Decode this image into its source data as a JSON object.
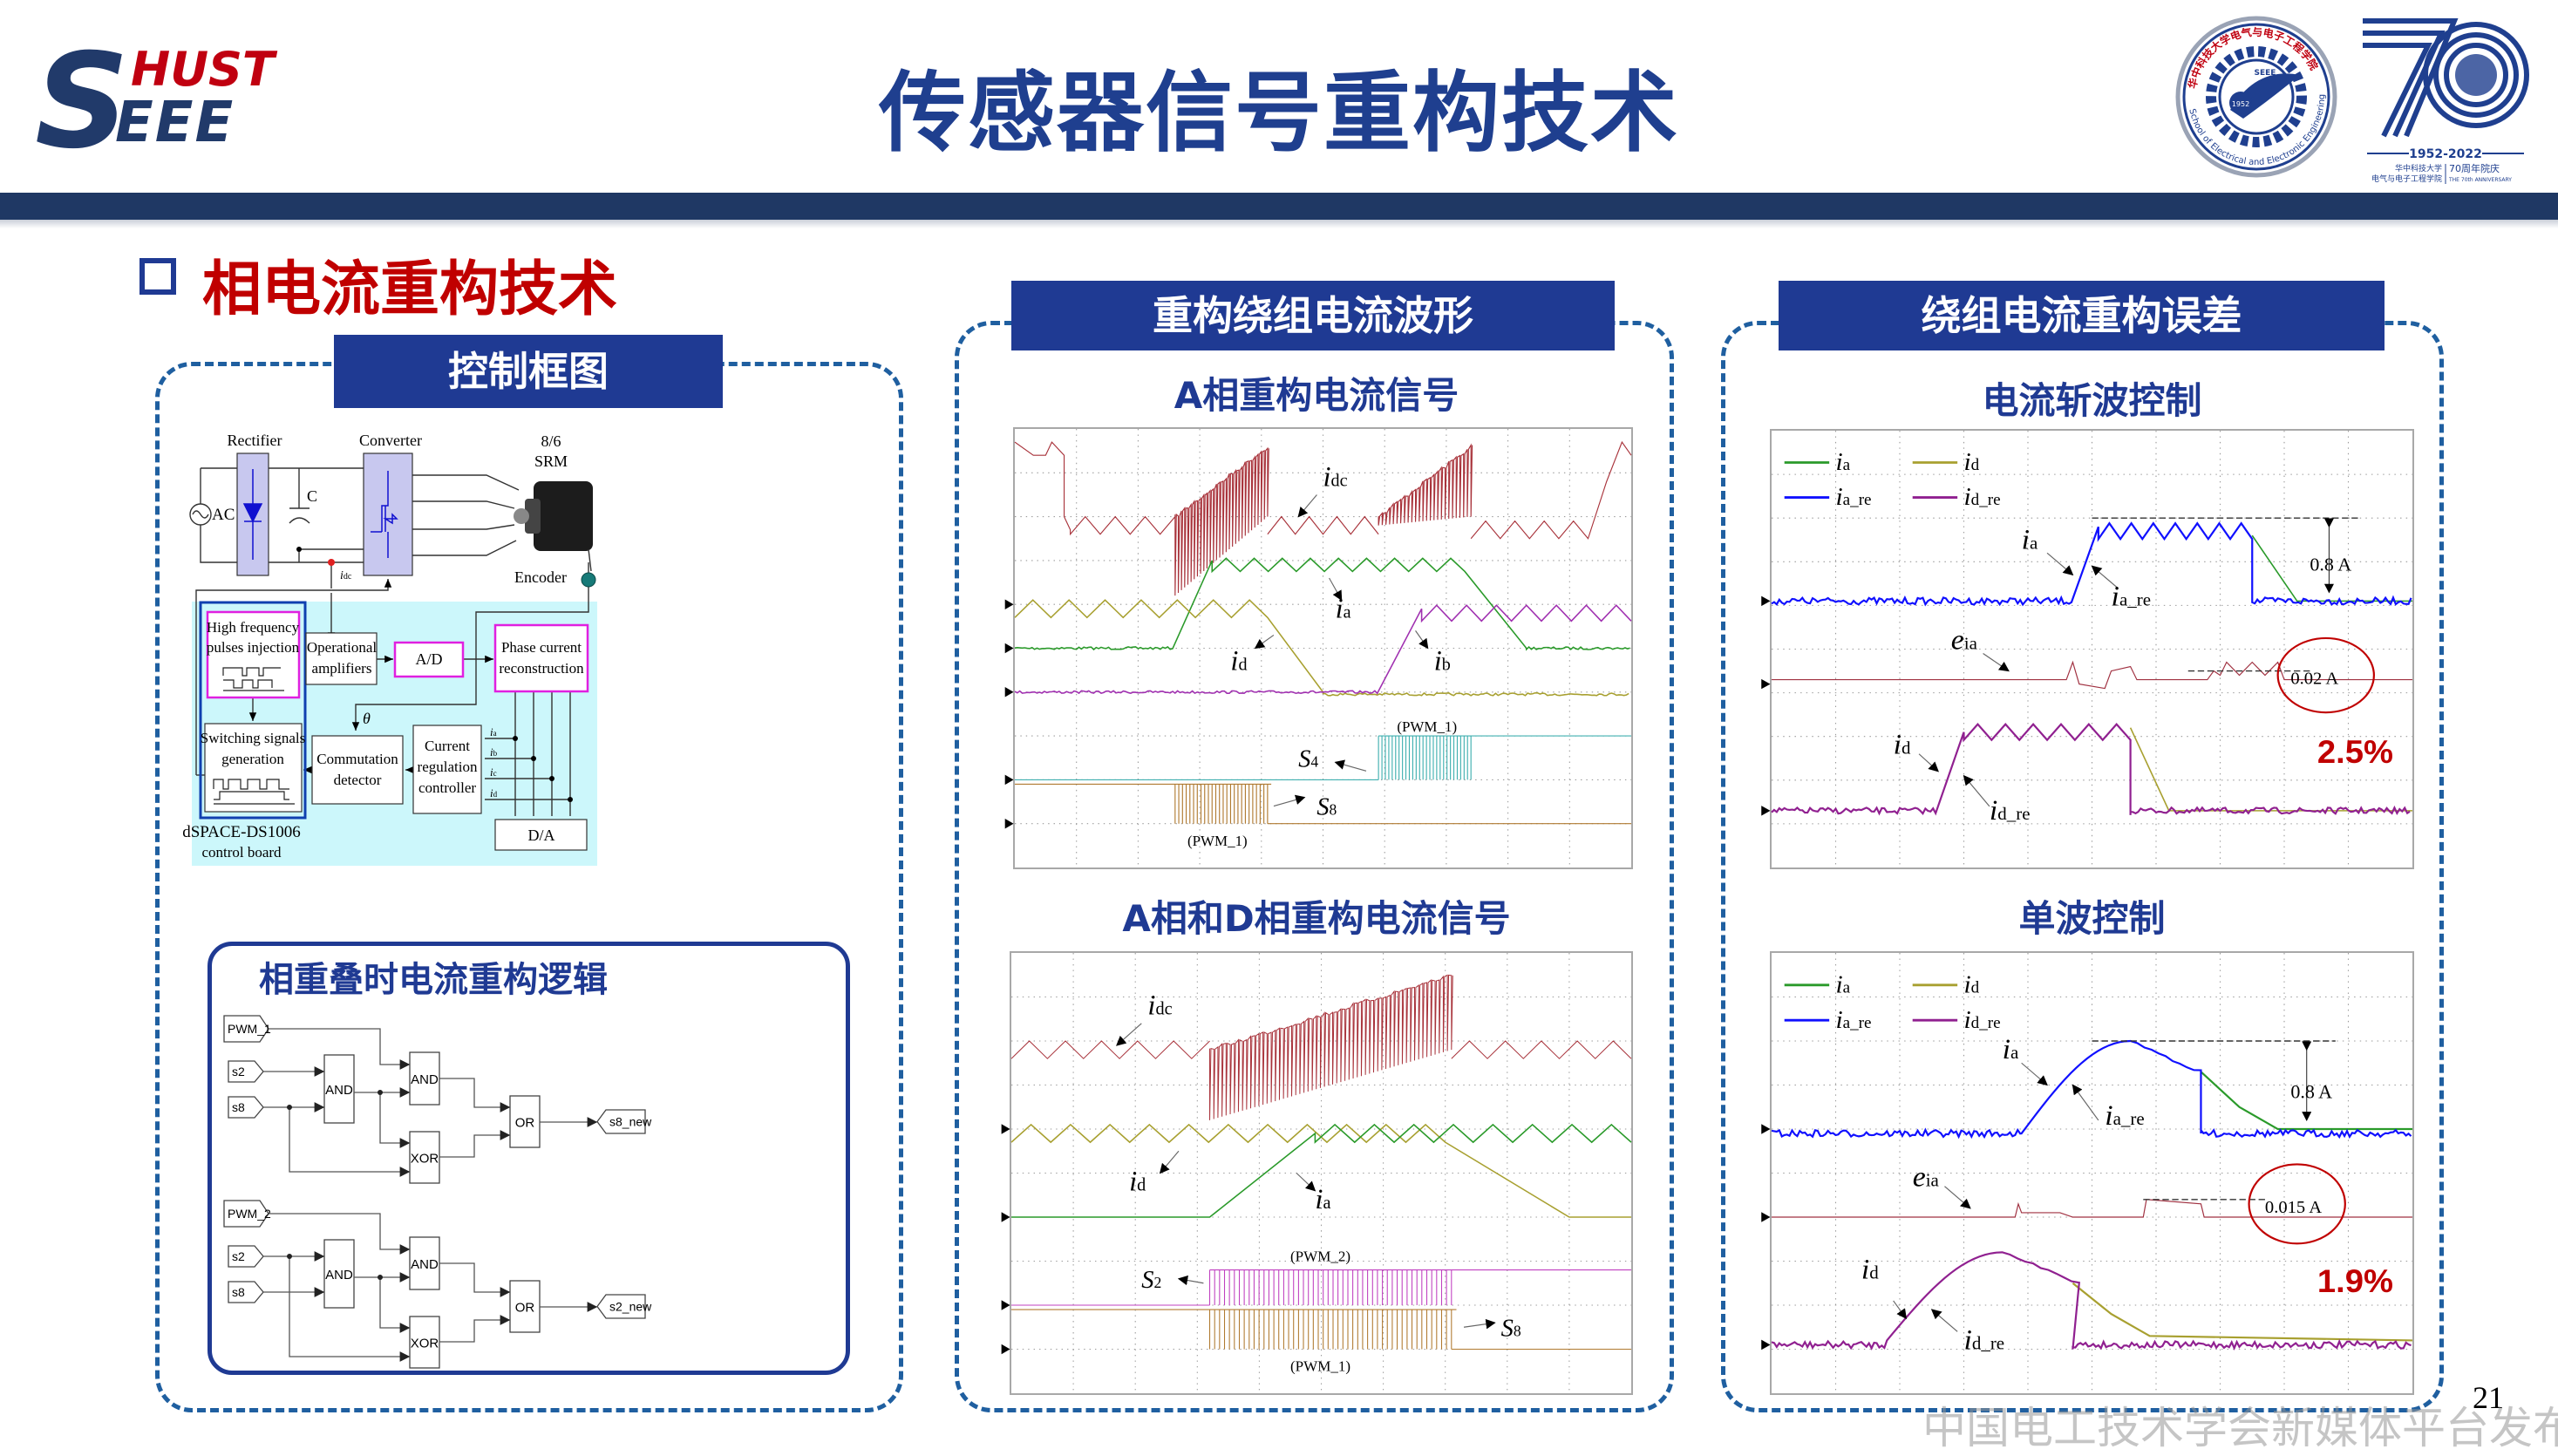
{
  "header": {
    "title": "传感器信号重构技术",
    "logo_top": "HUST",
    "logo_bottom": "SEEE",
    "seal_cn": "华中科技大学电气与电子工程学院",
    "seal_en": "School of Electrical and Electronic Engineering",
    "seal_year": "1952",
    "seal_mark": "SEEE",
    "anniv_number": "70",
    "anniv_years": "1952-2022",
    "anniv_school_1": "华中科技大学",
    "anniv_school_2": "电气与电子工程学院",
    "anniv_cn": "70周年院庆",
    "anniv_en": "THE 70th ANNIVERSARY"
  },
  "section": {
    "title": "相电流重构技术"
  },
  "left_panel": {
    "label": "控制框图",
    "block_diagram": {
      "rectifier": "Rectifier",
      "converter": "Converter",
      "srm_1": "8/6",
      "srm_2": "SRM",
      "ac": "AC",
      "capacitor": "C",
      "idc_main": "i",
      "idc_sub": "dc",
      "encoder": "Encoder",
      "hf_1": "High frequency",
      "hf_2": "pulses injection",
      "opamp_1": "Operational",
      "opamp_2": "amplifiers",
      "ad": "A/D",
      "pcr_1": "Phase current",
      "pcr_2": "reconstruction",
      "theta": "θ",
      "sw_1": "Switching signals",
      "sw_2": "generation",
      "comm_1": "Commutation",
      "comm_2": "detector",
      "crc_1": "Current",
      "crc_2": "regulation",
      "crc_3": "controller",
      "phase_currents": [
        {
          "main": "i",
          "sub": "a"
        },
        {
          "main": "i",
          "sub": "b"
        },
        {
          "main": "i",
          "sub": "c"
        },
        {
          "main": "i",
          "sub": "d"
        }
      ],
      "da": "D/A",
      "board_1": "dSPACE-DS1006",
      "board_2": "control board"
    },
    "logic": {
      "title": "相重叠时电流重构逻辑",
      "groups": [
        {
          "pwm": "PWM_1",
          "in1": "s2",
          "in2": "s8",
          "and1": "AND",
          "and2": "AND",
          "xor": "XOR",
          "or": "OR",
          "out": "s8_new"
        },
        {
          "pwm": "PWM_2",
          "in1": "s2",
          "in2": "s8",
          "and1": "AND",
          "and2": "AND",
          "xor": "XOR",
          "or": "OR",
          "out": "s2_new"
        }
      ]
    }
  },
  "middle_panel": {
    "label": "重构绕组电流波形",
    "scope_top": {
      "title": "A相重构电流信号",
      "labels": [
        {
          "main": "i",
          "sub": "dc"
        },
        {
          "main": "i",
          "sub": "a"
        },
        {
          "main": "i",
          "sub": "d"
        },
        {
          "main": "i",
          "sub": "b"
        },
        {
          "main": "S",
          "sub": "4"
        },
        {
          "main": "S",
          "sub": "8"
        }
      ],
      "annotations": [
        "(PWM_1)",
        "(PWM_1)"
      ]
    },
    "scope_bottom": {
      "title": "A相和D相重构电流信号",
      "labels": [
        {
          "main": "i",
          "sub": "dc"
        },
        {
          "main": "i",
          "sub": "d"
        },
        {
          "main": "i",
          "sub": "a"
        },
        {
          "main": "S",
          "sub": "2"
        },
        {
          "main": "S",
          "sub": "8"
        }
      ],
      "annotations": [
        "(PWM_2)",
        "(PWM_1)"
      ]
    }
  },
  "right_panel": {
    "label": "绕组电流重构误差",
    "scope_top": {
      "title": "电流斩波控制",
      "legend": [
        {
          "main": "i",
          "sub": "a"
        },
        {
          "main": "i",
          "sub": "d"
        },
        {
          "main": "i",
          "sub": "a_re"
        },
        {
          "main": "i",
          "sub": "d_re"
        }
      ],
      "labels": [
        {
          "main": "i",
          "sub": "a"
        },
        {
          "main": "i",
          "sub": "a_re"
        },
        {
          "main": "e",
          "sub": "ia"
        },
        {
          "main": "i",
          "sub": "d"
        },
        {
          "main": "i",
          "sub": "d_re"
        }
      ],
      "peak": "0.8 A",
      "error_abs": "0.02 A",
      "error_pct": "2.5%"
    },
    "scope_bottom": {
      "title": "单波控制",
      "legend": [
        {
          "main": "i",
          "sub": "a"
        },
        {
          "main": "i",
          "sub": "d"
        },
        {
          "main": "i",
          "sub": "a_re"
        },
        {
          "main": "i",
          "sub": "d_re"
        }
      ],
      "labels": [
        {
          "main": "i",
          "sub": "a"
        },
        {
          "main": "i",
          "sub": "a_re"
        },
        {
          "main": "e",
          "sub": "ia"
        },
        {
          "main": "i",
          "sub": "d"
        },
        {
          "main": "i",
          "sub": "d_re"
        }
      ],
      "peak": "0.8 A",
      "error_abs": "0.015 A",
      "error_pct": "1.9%"
    }
  },
  "page_number": "21",
  "watermark": "中国电工技术学会新媒体平台发布",
  "colors": {
    "navy_bar": "#1f3864",
    "accent_blue": "#1f3a93",
    "heading_red": "#c00000",
    "panel_border": "#1f5fa0",
    "trace_ia": "#2a9a2a",
    "trace_ia_re": "#1010ff",
    "trace_id": "#a8a030",
    "trace_id_re": "#902090",
    "trace_idc": "#a8323a"
  }
}
